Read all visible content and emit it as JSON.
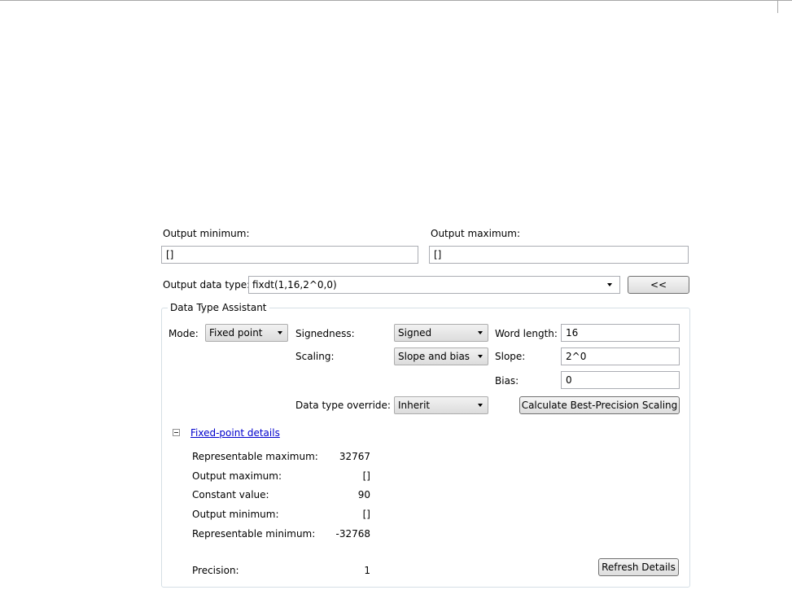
{
  "output_min": {
    "label": "Output minimum:",
    "value": "[]"
  },
  "output_max": {
    "label": "Output maximum:",
    "value": "[]"
  },
  "output_data_type": {
    "label": "Output data type:",
    "value": "fixdt(1,16,2^0,0)",
    "toggle_button": "<<"
  },
  "assistant": {
    "title": "Data Type Assistant",
    "mode": {
      "label": "Mode:",
      "value": "Fixed point"
    },
    "signedness": {
      "label": "Signedness:",
      "value": "Signed"
    },
    "word_length": {
      "label": "Word length:",
      "value": "16"
    },
    "scaling": {
      "label": "Scaling:",
      "value": "Slope and bias"
    },
    "slope": {
      "label": "Slope:",
      "value": "2^0"
    },
    "bias": {
      "label": "Bias:",
      "value": "0"
    },
    "override": {
      "label": "Data type override:",
      "value": "Inherit"
    },
    "calc_button": "Calculate Best-Precision Scaling"
  },
  "details": {
    "title": "Fixed-point details",
    "rows": [
      {
        "label": "Representable maximum:",
        "value": "32767"
      },
      {
        "label": "Output maximum:",
        "value": "[]"
      },
      {
        "label": "Constant value:",
        "value": "90"
      },
      {
        "label": "Output minimum:",
        "value": "[]"
      },
      {
        "label": "Representable minimum:",
        "value": "-32768"
      }
    ],
    "precision": {
      "label": "Precision:",
      "value": "1"
    },
    "refresh_button": "Refresh Details"
  }
}
